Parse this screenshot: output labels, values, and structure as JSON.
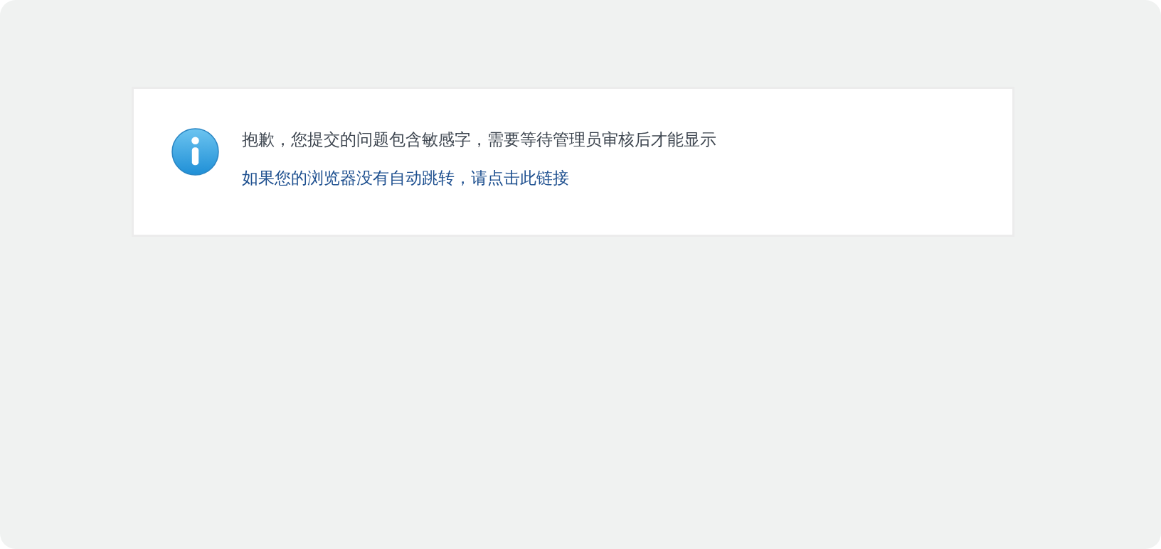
{
  "notice": {
    "message": "抱歉，您提交的问题包含敏感字，需要等待管理员审核后才能显示",
    "link": "如果您的浏览器没有自动跳转，请点击此链接"
  }
}
